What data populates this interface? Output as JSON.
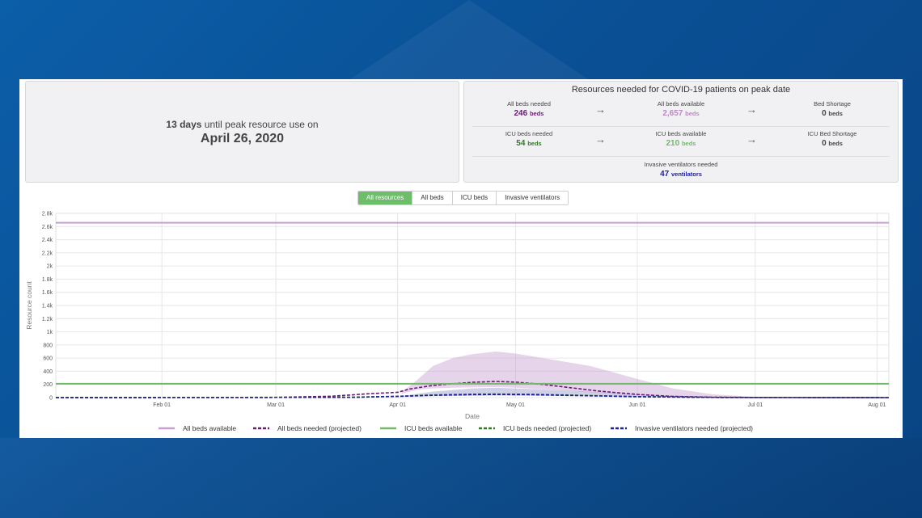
{
  "summary": {
    "days_until": "13 days",
    "until_text": " until peak resource use on",
    "peak_date": "April 26, 2020"
  },
  "resources": {
    "title": "Resources needed for COVID-19 patients on peak date",
    "row1": [
      {
        "label": "All beds needed",
        "value": "246",
        "unit": "beds",
        "color": "#6a1a73"
      },
      {
        "label": "All beds available",
        "value": "2,657",
        "unit": "beds",
        "color": "#b98ac1"
      },
      {
        "label": "Bed Shortage",
        "value": "0",
        "unit": "beds",
        "color": "#444444"
      }
    ],
    "row2": [
      {
        "label": "ICU beds needed",
        "value": "54",
        "unit": "beds",
        "color": "#2f7a23"
      },
      {
        "label": "ICU beds available",
        "value": "210",
        "unit": "beds",
        "color": "#74b86b"
      },
      {
        "label": "ICU Bed Shortage",
        "value": "0",
        "unit": "beds",
        "color": "#444444"
      }
    ],
    "ventilators": {
      "label": "Invasive ventilators needed",
      "value": "47",
      "unit": "ventilators",
      "color": "#1d1fa0"
    }
  },
  "tabs": [
    {
      "label": "All resources",
      "active": true
    },
    {
      "label": "All beds",
      "active": false
    },
    {
      "label": "ICU beds",
      "active": false
    },
    {
      "label": "Invasive ventilators",
      "active": false
    }
  ],
  "chart_data": {
    "type": "line",
    "xlabel": "Date",
    "ylabel": "Resource count",
    "x_range": [
      "2020-01-05",
      "2020-08-04"
    ],
    "ylim": [
      0,
      2800
    ],
    "y_ticks": [
      0,
      200,
      400,
      600,
      800,
      1000,
      1200,
      1400,
      1600,
      1800,
      2000,
      2200,
      2400,
      2600,
      2800
    ],
    "y_tick_labels": [
      "0",
      "200",
      "400",
      "600",
      "800",
      "1k",
      "1.2k",
      "1.4k",
      "1.6k",
      "1.8k",
      "2k",
      "2.2k",
      "2.4k",
      "2.6k",
      "2.8k"
    ],
    "x_ticks": [
      "2020-02-01",
      "2020-03-01",
      "2020-04-01",
      "2020-05-01",
      "2020-06-01",
      "2020-07-01",
      "2020-08-01"
    ],
    "x_tick_labels": [
      "Feb 01",
      "Mar 01",
      "Apr 01",
      "May 01",
      "Jun 01",
      "Jul 01",
      "Aug 01"
    ],
    "grid": true,
    "legend_position": "bottom",
    "series": [
      {
        "name": "All beds available",
        "color": "#c79fd0",
        "style": "solid",
        "x": [
          "2020-01-05",
          "2020-08-04"
        ],
        "y": [
          2657,
          2657
        ]
      },
      {
        "name": "All beds needed (projected)",
        "color": "#6a1a73",
        "style": "dashed",
        "x": [
          "2020-01-05",
          "2020-03-01",
          "2020-03-15",
          "2020-03-25",
          "2020-04-01",
          "2020-04-04",
          "2020-04-10",
          "2020-04-15",
          "2020-04-20",
          "2020-04-26",
          "2020-05-01",
          "2020-05-08",
          "2020-05-15",
          "2020-05-22",
          "2020-06-01",
          "2020-06-10",
          "2020-06-20",
          "2020-07-01",
          "2020-08-04"
        ],
        "y": [
          0,
          3,
          20,
          60,
          80,
          130,
          185,
          210,
          232,
          246,
          235,
          200,
          150,
          100,
          48,
          18,
          6,
          2,
          0
        ]
      },
      {
        "name": "ICU beds available",
        "color": "#74b86b",
        "style": "solid",
        "x": [
          "2020-01-05",
          "2020-08-04"
        ],
        "y": [
          210,
          210
        ]
      },
      {
        "name": "ICU beds needed (projected)",
        "color": "#2f7a23",
        "style": "dashed",
        "x": [
          "2020-01-05",
          "2020-03-20",
          "2020-04-01",
          "2020-04-10",
          "2020-04-20",
          "2020-04-26",
          "2020-05-05",
          "2020-05-15",
          "2020-06-01",
          "2020-06-20",
          "2020-08-04"
        ],
        "y": [
          0,
          5,
          20,
          40,
          52,
          54,
          50,
          38,
          15,
          3,
          0
        ]
      },
      {
        "name": "Invasive ventilators needed (projected)",
        "color": "#1d1fa0",
        "style": "dashed",
        "x": [
          "2020-01-05",
          "2020-03-20",
          "2020-04-01",
          "2020-04-10",
          "2020-04-20",
          "2020-04-26",
          "2020-05-05",
          "2020-05-15",
          "2020-06-01",
          "2020-06-20",
          "2020-08-04"
        ],
        "y": [
          0,
          4,
          18,
          35,
          45,
          47,
          44,
          33,
          13,
          3,
          0
        ]
      }
    ],
    "bands": [
      {
        "series": "All beds needed (projected)",
        "color": "#c79fd0",
        "x": [
          "2020-04-02",
          "2020-04-06",
          "2020-04-10",
          "2020-04-15",
          "2020-04-20",
          "2020-04-26",
          "2020-05-01",
          "2020-05-10",
          "2020-05-20",
          "2020-05-31",
          "2020-06-10",
          "2020-06-20",
          "2020-07-01"
        ],
        "upper": [
          80,
          270,
          480,
          600,
          660,
          700,
          670,
          580,
          480,
          300,
          140,
          50,
          10
        ],
        "lower": [
          60,
          120,
          140,
          150,
          155,
          160,
          150,
          120,
          80,
          40,
          15,
          5,
          0
        ]
      },
      {
        "series": "ICU beds needed (projected)",
        "color": "#9a96cf",
        "x": [
          "2020-04-02",
          "2020-04-10",
          "2020-04-20",
          "2020-04-26",
          "2020-05-05",
          "2020-05-20",
          "2020-06-05",
          "2020-06-20"
        ],
        "upper": [
          25,
          90,
          140,
          150,
          130,
          90,
          40,
          10
        ],
        "lower": [
          10,
          20,
          28,
          30,
          28,
          20,
          8,
          2
        ]
      }
    ]
  }
}
